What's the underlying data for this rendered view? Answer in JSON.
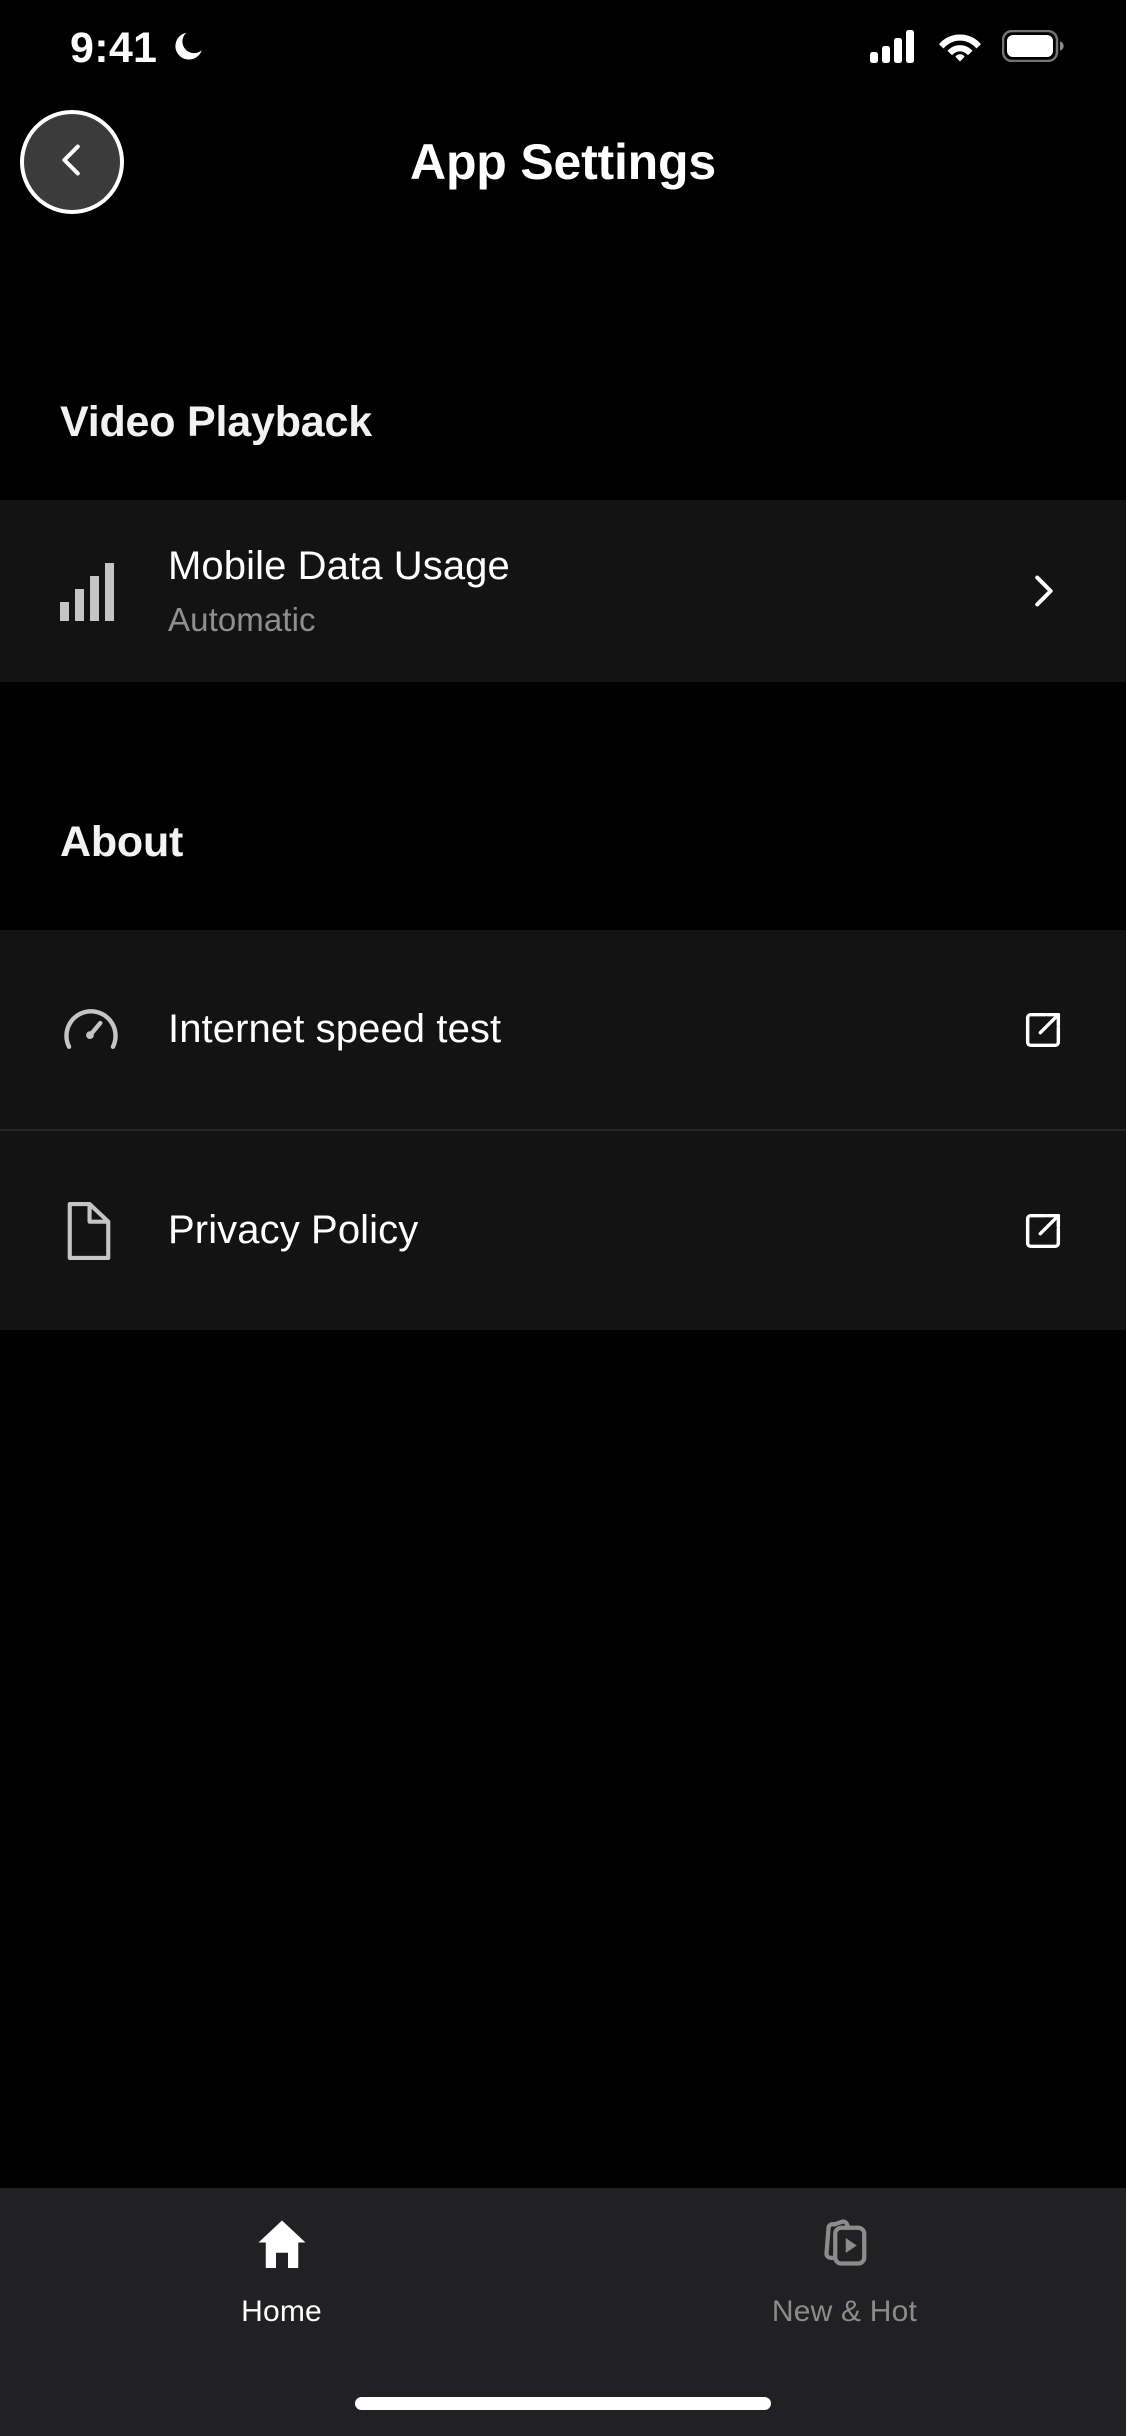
{
  "status_bar": {
    "time": "9:41",
    "dnd_icon": "crescent-moon-icon",
    "cellular_icon": "cellular-signal-icon",
    "wifi_icon": "wifi-icon",
    "battery_icon": "battery-full-icon"
  },
  "header": {
    "back_icon": "chevron-left-icon",
    "title": "App Settings"
  },
  "sections": [
    {
      "title": "Video Playback",
      "rows": [
        {
          "icon": "bar-chart-icon",
          "title": "Mobile Data Usage",
          "subtitle": "Automatic",
          "accessory": "chevron-right-icon"
        }
      ]
    },
    {
      "title": "About",
      "rows": [
        {
          "icon": "speedometer-icon",
          "title": "Internet speed test",
          "subtitle": "",
          "accessory": "external-link-icon"
        },
        {
          "icon": "document-icon",
          "title": "Privacy Policy",
          "subtitle": "",
          "accessory": "external-link-icon"
        }
      ]
    }
  ],
  "tab_bar": {
    "tabs": [
      {
        "label": "Home",
        "icon": "home-icon",
        "active": true
      },
      {
        "label": "New & Hot",
        "icon": "new-and-hot-icon",
        "active": false
      }
    ]
  },
  "colors": {
    "page_background": "#000000",
    "card_background": "#131314",
    "tab_bar_background": "#212123",
    "primary_text": "#ffffff",
    "secondary_text": "#8f8f8f",
    "icon_gray": "#c5c5c5",
    "divider": "#272728"
  }
}
